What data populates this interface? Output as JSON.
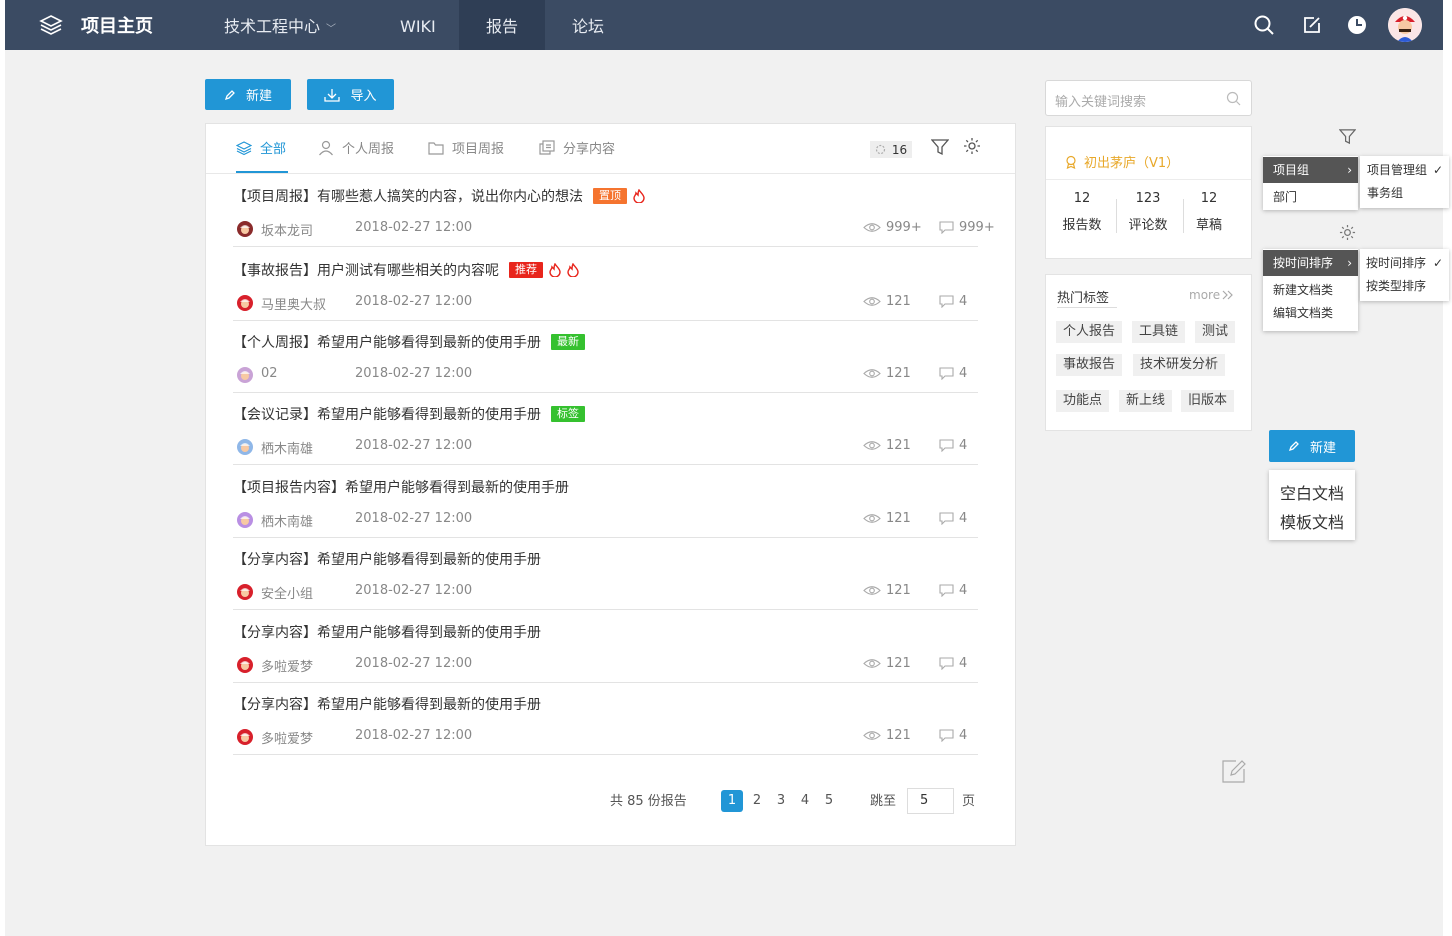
{
  "topbar": {
    "title": "项目主页",
    "nav": [
      {
        "label": "技术工程中心",
        "caret": "﹀"
      },
      {
        "label": "WIKI"
      },
      {
        "label": "报告"
      },
      {
        "label": "论坛"
      }
    ]
  },
  "toolbar": {
    "new_label": "新建",
    "import_label": "导入"
  },
  "tabs": [
    {
      "label": "全部"
    },
    {
      "label": "个人周报"
    },
    {
      "label": "项目周报"
    },
    {
      "label": "分享内容"
    }
  ],
  "refresh_count": "16",
  "reports": [
    {
      "title": "【项目周报】有哪些惹人搞笑的内容，说出你内心的想法",
      "badge": "置顶",
      "badge_color": "#f5742f",
      "fires": 1,
      "author": "坂本龙司",
      "date": "2018-02-27  12:00",
      "views": "999+",
      "comments": "999+"
    },
    {
      "title": "【事故报告】用户测试有哪些相关的内容呢",
      "badge": "推荐",
      "badge_color": "#e8251c",
      "fires": 2,
      "author": "马里奥大叔",
      "date": "2018-02-27  12:00",
      "views": "121",
      "comments": "4"
    },
    {
      "title": "【个人周报】希望用户能够看得到最新的使用手册",
      "badge": "最新",
      "badge_color": "#35c12f",
      "fires": 0,
      "author": "02",
      "date": "2018-02-27  12:00",
      "views": "121",
      "comments": "4"
    },
    {
      "title": "【会议记录】希望用户能够看得到最新的使用手册",
      "badge": "标签",
      "badge_color": "#35c12f",
      "fires": 0,
      "author": "栖木南雄",
      "date": "2018-02-27  12:00",
      "views": "121",
      "comments": "4"
    },
    {
      "title": "【项目报告内容】希望用户能够看得到最新的使用手册",
      "badge": "",
      "badge_color": "",
      "fires": 0,
      "author": "栖木南雄",
      "date": "2018-02-27  12:00",
      "views": "121",
      "comments": "4"
    },
    {
      "title": "【分享内容】希望用户能够看得到最新的使用手册",
      "badge": "",
      "badge_color": "",
      "fires": 0,
      "author": "安全小组",
      "date": "2018-02-27  12:00",
      "views": "121",
      "comments": "4"
    },
    {
      "title": "【分享内容】希望用户能够看得到最新的使用手册",
      "badge": "",
      "badge_color": "",
      "fires": 0,
      "author": "多啦爱梦",
      "date": "2018-02-27  12:00",
      "views": "121",
      "comments": "4"
    },
    {
      "title": "【分享内容】希望用户能够看得到最新的使用手册",
      "badge": "",
      "badge_color": "",
      "fires": 0,
      "author": "多啦爱梦",
      "date": "2018-02-27  12:00",
      "views": "121",
      "comments": "4"
    }
  ],
  "pagination": {
    "total_text": "共 85 份报告",
    "pages": [
      "1",
      "2",
      "3",
      "4",
      "5"
    ],
    "current": "1",
    "jump_label": "跳至",
    "jump_value": "5",
    "page_suffix": "页"
  },
  "sidebar": {
    "search_placeholder": "输入关键词搜索",
    "project_name": "初出茅庐（V1）",
    "stats": [
      {
        "value": "12",
        "label": "报告数"
      },
      {
        "value": "123",
        "label": "评论数"
      },
      {
        "value": "12",
        "label": "草稿"
      }
    ],
    "hot_tags_title": "热门标签",
    "more_label": "more",
    "tags": [
      "个人报告",
      "工具链",
      "测试",
      "事故报告",
      "技术研发分析",
      "功能点",
      "新上线",
      "旧版本"
    ]
  },
  "menus": {
    "group_menu": [
      "项目组",
      "部门"
    ],
    "group_sub": [
      "项目管理组",
      "事务组"
    ],
    "sort_menu": [
      "按时间排序",
      "新建文档类",
      "编辑文档类"
    ],
    "sort_sub": [
      "按时间排序",
      "按类型排序"
    ],
    "new_button": "新建",
    "new_options": [
      "空白文档",
      "模板文档"
    ]
  }
}
